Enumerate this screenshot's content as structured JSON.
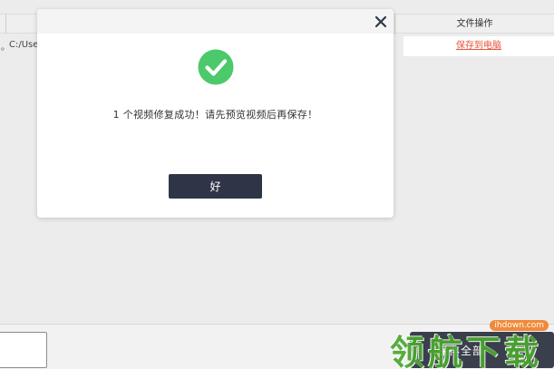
{
  "table": {
    "header": {
      "file_ops_label": "文件操作"
    },
    "row": {
      "dot": "。",
      "path": "C:/Use",
      "save_link": "保存到电脑"
    }
  },
  "footer": {
    "save_all_label": "保存全部"
  },
  "modal": {
    "message": "1 个视频修复成功！请先预览视频后再保存！",
    "ok_label": "好",
    "success_color": "#4cc96b"
  },
  "watermark": {
    "url": "ihdown.com",
    "text": "领航下载"
  }
}
